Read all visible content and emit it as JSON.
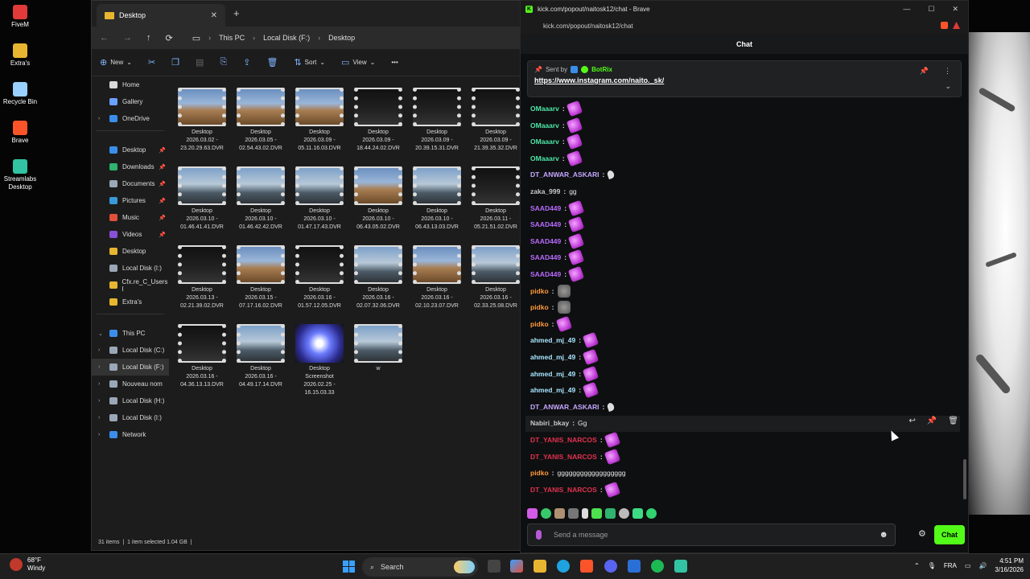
{
  "desktop": {
    "icons": [
      {
        "label": "FiveM",
        "color": "#e03a3a"
      },
      {
        "label": "Extra's",
        "color": "#e8b530"
      },
      {
        "label": "Recycle Bin",
        "color": "#9ad0ff"
      },
      {
        "label": "Brave",
        "color": "#fb542b"
      },
      {
        "label": "Streamlabs Desktop",
        "color": "#31c3a2"
      }
    ]
  },
  "explorer": {
    "tab_title": "Desktop",
    "breadcrumb": [
      "This PC",
      "Local Disk (F:)",
      "Desktop"
    ],
    "commands": {
      "new": "New",
      "sort": "Sort",
      "view": "View"
    },
    "sidebar": [
      {
        "label": "Home",
        "pin": false,
        "color": "#d9d9d9"
      },
      {
        "label": "Gallery",
        "pin": false,
        "color": "#6aa0ff"
      },
      {
        "label": "OneDrive",
        "pin": false,
        "color": "#3a8eea",
        "chevron": true
      },
      {
        "label": "Desktop",
        "pin": true,
        "color": "#3a8eea"
      },
      {
        "label": "Downloads",
        "pin": true,
        "color": "#2fb36f"
      },
      {
        "label": "Documents",
        "pin": true,
        "color": "#9aa7b6"
      },
      {
        "label": "Pictures",
        "pin": true,
        "color": "#3a9ad9"
      },
      {
        "label": "Music",
        "pin": true,
        "color": "#e0503a"
      },
      {
        "label": "Videos",
        "pin": true,
        "color": "#8a4fd6"
      },
      {
        "label": "Desktop",
        "pin": false,
        "color": "#e8b530"
      },
      {
        "label": "Local Disk (I:)",
        "pin": false,
        "color": "#9aa7b6"
      },
      {
        "label": "Cfx.re_C_Users I",
        "pin": false,
        "color": "#e8b530"
      },
      {
        "label": "Extra's",
        "pin": false,
        "color": "#e8b530"
      }
    ],
    "sidebar_pc": [
      {
        "label": "This PC",
        "chevron": "open",
        "color": "#3a8eea"
      },
      {
        "label": "Local Disk (C:)",
        "chevron": "closed",
        "color": "#9aa7b6"
      },
      {
        "label": "Local Disk (F:)",
        "chevron": "closed",
        "color": "#9aa7b6",
        "selected": true
      },
      {
        "label": "Nouveau nom",
        "chevron": "closed",
        "color": "#9aa7b6"
      },
      {
        "label": "Local Disk (H:)",
        "chevron": "closed",
        "color": "#9aa7b6"
      },
      {
        "label": "Local Disk (I:)",
        "chevron": "closed",
        "color": "#9aa7b6"
      },
      {
        "label": "Network",
        "chevron": "closed",
        "color": "#3a8eea"
      }
    ],
    "files": [
      {
        "name": "Desktop",
        "sub": "2026.03.02 -",
        "sub2": "23.20.29.63.DVR",
        "thumb": "sand"
      },
      {
        "name": "Desktop",
        "sub": "2026.03.05 -",
        "sub2": "02.54.43.02.DVR",
        "thumb": "sand"
      },
      {
        "name": "Desktop",
        "sub": "2026.03.09 -",
        "sub2": "05.11.16.03.DVR",
        "thumb": "sand"
      },
      {
        "name": "Desktop",
        "sub": "2026.03.09 -",
        "sub2": "18.44.24.02.DVR",
        "thumb": "dark"
      },
      {
        "name": "Desktop",
        "sub": "2026.03.09 -",
        "sub2": "20.39.15.31.DVR",
        "thumb": "dark"
      },
      {
        "name": "Desktop",
        "sub": "2026.03.09 -",
        "sub2": "21.39.35.32.DVR",
        "thumb": "dark"
      },
      {
        "name": "Desktop",
        "sub": "2026.03.10 -",
        "sub2": "01.46.41.41.DVR",
        "thumb": "city"
      },
      {
        "name": "Desktop",
        "sub": "2026.03.10 -",
        "sub2": "01.46.42.42.DVR",
        "thumb": "city"
      },
      {
        "name": "Desktop",
        "sub": "2026.03.10 -",
        "sub2": "01.47.17.43.DVR",
        "thumb": "city"
      },
      {
        "name": "Desktop",
        "sub": "2026.03.10 -",
        "sub2": "06.43.05.02.DVR",
        "thumb": "sand"
      },
      {
        "name": "Desktop",
        "sub": "2026.03.10 -",
        "sub2": "06.43.13.03.DVR",
        "thumb": "city"
      },
      {
        "name": "Desktop",
        "sub": "2026.03.11 -",
        "sub2": "05.21.51.02.DVR",
        "thumb": "dark"
      },
      {
        "name": "Desktop",
        "sub": "2026.03.13 -",
        "sub2": "02.21.39.02.DVR",
        "thumb": "dark"
      },
      {
        "name": "Desktop",
        "sub": "2026.03.15 -",
        "sub2": "07.17.16.02.DVR",
        "thumb": "sand"
      },
      {
        "name": "Desktop",
        "sub": "2026.03.16 -",
        "sub2": "01.57.12.05.DVR",
        "thumb": "dark"
      },
      {
        "name": "Desktop",
        "sub": "2026.03.16 -",
        "sub2": "02.07.32.06.DVR",
        "thumb": "city"
      },
      {
        "name": "Desktop",
        "sub": "2026.03.16 -",
        "sub2": "02.10.23.07.DVR",
        "thumb": "sand"
      },
      {
        "name": "Desktop",
        "sub": "2026.03.16 -",
        "sub2": "02.33.25.08.DVR",
        "thumb": "city"
      },
      {
        "name": "Desktop",
        "sub": "2026.03.16 -",
        "sub2": "04.36.13.13.DVR",
        "thumb": "dark"
      },
      {
        "name": "Desktop",
        "sub": "2026.03.16 -",
        "sub2": "04.49.17.14.DVR",
        "thumb": "city"
      },
      {
        "name": "Desktop",
        "sub": "Screenshot",
        "sub2": "2026.02.25 -",
        "sub3": "16.15.03.33",
        "thumb": "anime"
      },
      {
        "name": "w",
        "sub": "",
        "sub2": "",
        "thumb": "city"
      }
    ],
    "status": {
      "items": "31 items",
      "selected": "1 item selected  1.04 GB"
    }
  },
  "brave": {
    "title": "kick.com/popout/naitosk12/chat - Brave",
    "url": "kick.com/popout/naitosk12/chat",
    "chat_header": "Chat",
    "pinned": {
      "sent_by": "Sent by",
      "bot": "BotRix",
      "link": "https://www.instagram.com/naito._sk/"
    },
    "messages": [
      {
        "user": "OMaaarv",
        "color": "#4ee6a8",
        "text": "",
        "emote": "pink"
      },
      {
        "user": "OMaaarv",
        "color": "#4ee6a8",
        "text": "",
        "emote": "pink"
      },
      {
        "user": "OMaaarv",
        "color": "#4ee6a8",
        "text": "",
        "emote": "pink"
      },
      {
        "user": "OMaaarv",
        "color": "#4ee6a8",
        "text": "",
        "emote": "pink"
      },
      {
        "user": "DT_ANWAR_ASKARI",
        "color": "#c4a6ff",
        "text": "",
        "emote": "feather"
      },
      {
        "user": "zaka_999",
        "color": "#c9c9c9",
        "text": "gg",
        "emote": ""
      },
      {
        "user": "SAAD449",
        "color": "#b86bff",
        "text": "",
        "emote": "pink"
      },
      {
        "user": "SAAD449",
        "color": "#b86bff",
        "text": "",
        "emote": "pink"
      },
      {
        "user": "SAAD449",
        "color": "#b86bff",
        "text": "",
        "emote": "pink"
      },
      {
        "user": "SAAD449",
        "color": "#b86bff",
        "text": "",
        "emote": "pink"
      },
      {
        "user": "SAAD449",
        "color": "#b86bff",
        "text": "",
        "emote": "pink"
      },
      {
        "user": "pidko",
        "color": "#ff9a3c",
        "text": "",
        "emote": "rock"
      },
      {
        "user": "pidko",
        "color": "#ff9a3c",
        "text": "",
        "emote": "rock"
      },
      {
        "user": "pidko",
        "color": "#ff9a3c",
        "text": "",
        "emote": "pink"
      },
      {
        "user": "ahmed_mj_49",
        "color": "#a8e6ff",
        "text": "",
        "emote": "pink"
      },
      {
        "user": "ahmed_mj_49",
        "color": "#a8e6ff",
        "text": "",
        "emote": "pink"
      },
      {
        "user": "ahmed_mj_49",
        "color": "#a8e6ff",
        "text": "",
        "emote": "pink"
      },
      {
        "user": "ahmed_mj_49",
        "color": "#a8e6ff",
        "text": "",
        "emote": "pink"
      },
      {
        "user": "DT_ANWAR_ASKARI",
        "color": "#c4a6ff",
        "text": "",
        "emote": "feather"
      },
      {
        "user": "Nabiri_bkay",
        "color": "#c9c9c9",
        "text": "Gg",
        "emote": ""
      },
      {
        "user": "DT_YANIS_NARCOS",
        "color": "#e0324f",
        "text": "",
        "emote": "pink"
      },
      {
        "user": "DT_YANIS_NARCOS",
        "color": "#e0324f",
        "text": "",
        "emote": "pink"
      },
      {
        "user": "pidko",
        "color": "#ff9a3c",
        "text": "gggggggggggggggggg",
        "emote": ""
      },
      {
        "user": "DT_YANIS_NARCOS",
        "color": "#e0324f",
        "text": "",
        "emote": "pink"
      }
    ],
    "input_placeholder": "Send a message",
    "send_label": "Chat"
  },
  "taskbar": {
    "temp": "68°F",
    "weather": "Windy",
    "search": "Search",
    "lang": "FRA",
    "time": "4:51 PM",
    "date": "3/16/2026"
  }
}
